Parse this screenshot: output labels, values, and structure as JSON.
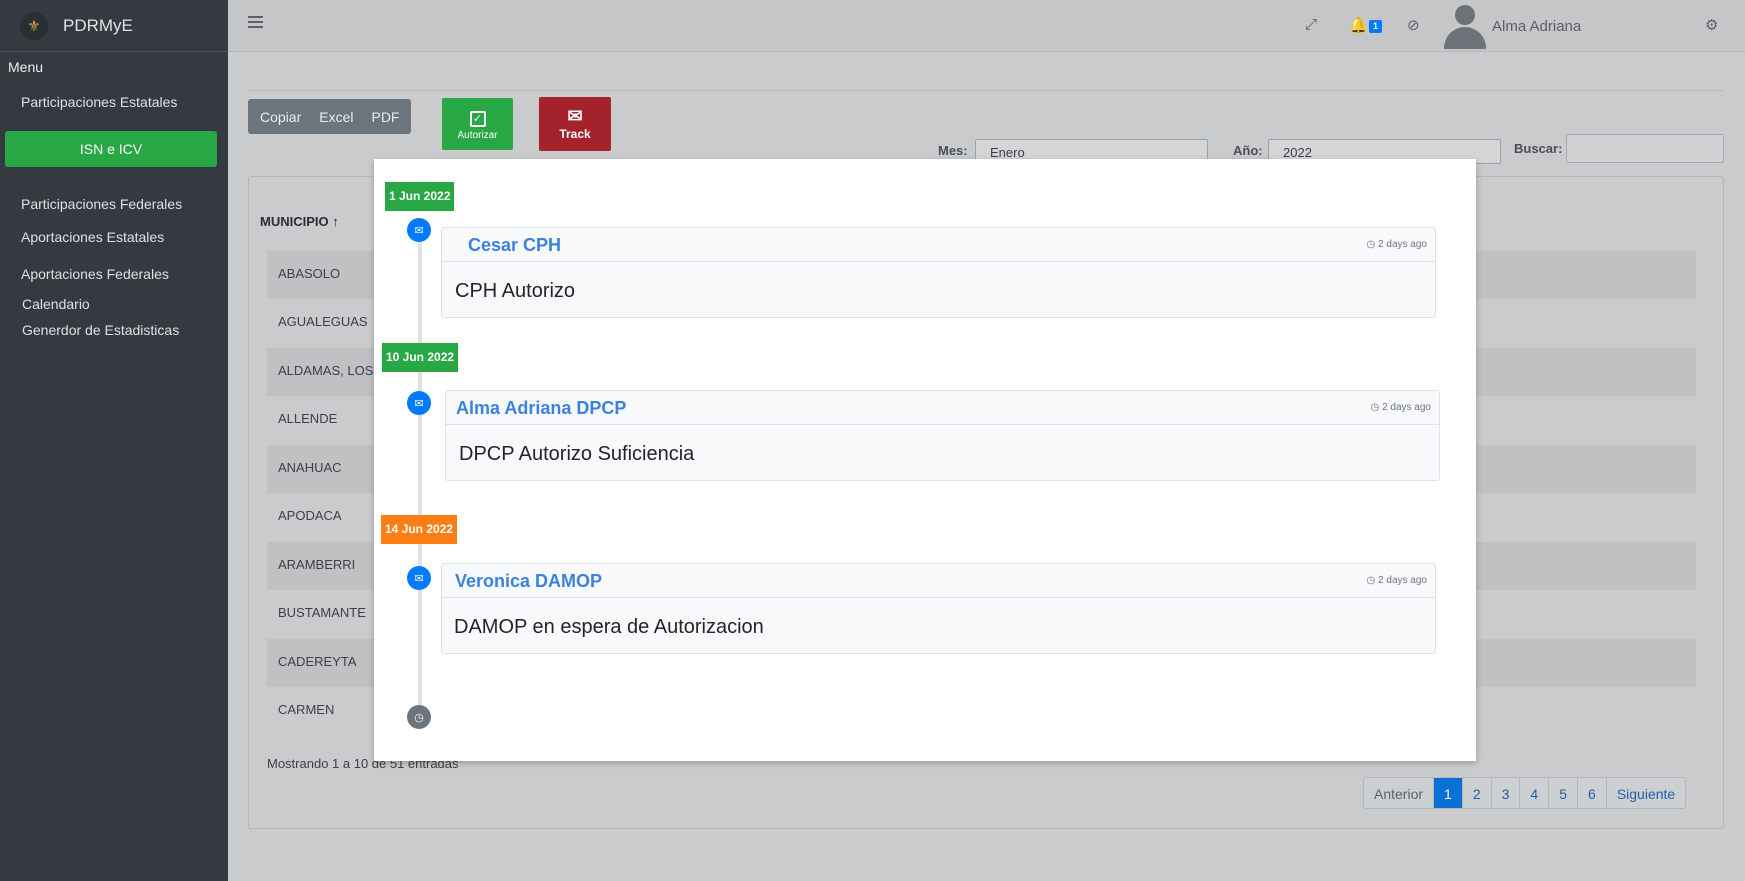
{
  "brand": {
    "name": "PDRMyE",
    "logo_icon": "brand-logo-icon"
  },
  "sidebar": {
    "menu_label": "Menu",
    "items": [
      {
        "label": "Participaciones Estatales"
      },
      {
        "label": "ISN e ICV",
        "active": true
      },
      {
        "label": "Participaciones Federales"
      },
      {
        "label": "Aportaciones Estatales"
      },
      {
        "label": "Aportaciones Federales"
      },
      {
        "label": "Calendario"
      },
      {
        "label": "Generdor de Estadisticas"
      }
    ]
  },
  "topbar": {
    "notification_count": "1",
    "user_name": "Alma Adriana",
    "icons": [
      "menu-icon",
      "fullscreen-icon",
      "bell-icon",
      "ban-icon",
      "user-avatar-icon",
      "settings-icon"
    ]
  },
  "toolbar": {
    "copy_label": "Copiar",
    "excel_label": "Excel",
    "pdf_label": "PDF",
    "authorize_label": "Autorizar",
    "track_label": "Track"
  },
  "filters": {
    "month_label": "Mes:",
    "month_value": "Enero",
    "year_label": "Año:",
    "year_value": "2022",
    "search_label": "Buscar:",
    "search_value": ""
  },
  "table": {
    "header_municipio": "MUNICIPIO",
    "rows": [
      "ABASOLO",
      "AGUALEGUAS",
      "ALDAMAS, LOS",
      "ALLENDE",
      "ANAHUAC",
      "APODACA",
      "ARAMBERRI",
      "BUSTAMANTE",
      "CADEREYTA",
      "CARMEN"
    ],
    "info": "Mostrando 1 a 10 de 51 entradas"
  },
  "pagination": {
    "prev": "Anterior",
    "pages": [
      "1",
      "2",
      "3",
      "4",
      "5",
      "6"
    ],
    "active_page": "1",
    "next": "Siguiente"
  },
  "timeline": {
    "colors": {
      "green": "#28a745",
      "orange": "#fd7e14",
      "blue": "#007bff"
    },
    "entries": [
      {
        "date": "1 Jun 2022",
        "date_color": "#28a745",
        "author": "Cesar CPH",
        "time": "2 days ago",
        "message": "CPH Autorizo"
      },
      {
        "date": "10 Jun 2022",
        "date_color": "#28a745",
        "author": "Alma Adriana DPCP",
        "time": "2 days ago",
        "message": "DPCP Autorizo Suficiencia"
      },
      {
        "date": "14 Jun 2022",
        "date_color": "#fd7e14",
        "author": "Veronica DAMOP",
        "time": "2 days ago",
        "message": "DAMOP en espera de Autorizacion"
      }
    ]
  }
}
